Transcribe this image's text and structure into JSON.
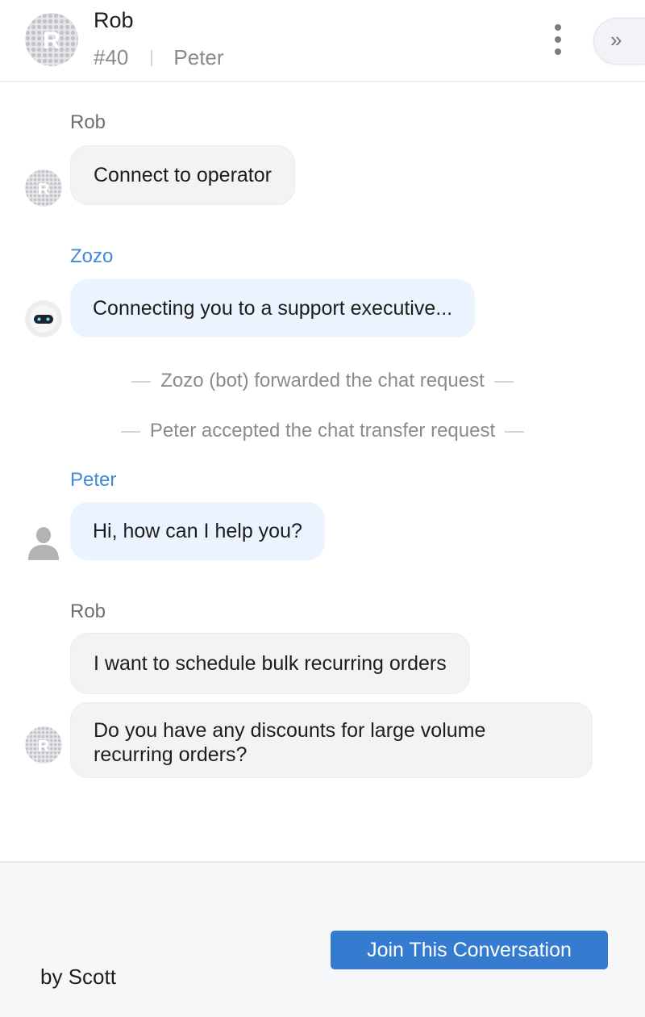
{
  "header": {
    "contact_name": "Rob",
    "avatar_initial": "R",
    "ticket_number": "#40",
    "assigned_agent": "Peter",
    "menu_icon": "kebab-menu-icon",
    "expand_icon": "double-chevron-right-icon",
    "expand_glyph": "»"
  },
  "messages": [
    {
      "type": "user",
      "sender": "Rob",
      "text": "Connect to operator"
    },
    {
      "type": "bot",
      "sender": "Zozo",
      "text": "Connecting you to a support executive..."
    },
    {
      "type": "system",
      "text": "Zozo (bot) forwarded the chat request"
    },
    {
      "type": "system",
      "text": "Peter accepted the chat transfer request"
    },
    {
      "type": "agent",
      "sender": "Peter",
      "text": "Hi, how can I help you?"
    },
    {
      "type": "user",
      "sender": "Rob",
      "text": "I want to schedule bulk recurring orders"
    },
    {
      "type": "user",
      "sender": "Rob",
      "text": "Do you have any discounts for large volume recurring orders?"
    }
  ],
  "footer": {
    "join_button_label": "Join This Conversation",
    "by_line": "by Scott"
  },
  "colors": {
    "accent": "#357bcf",
    "agent_name": "#3f8ad8",
    "agent_bubble": "#eaf3fe",
    "user_bubble": "#f3f3f3"
  }
}
